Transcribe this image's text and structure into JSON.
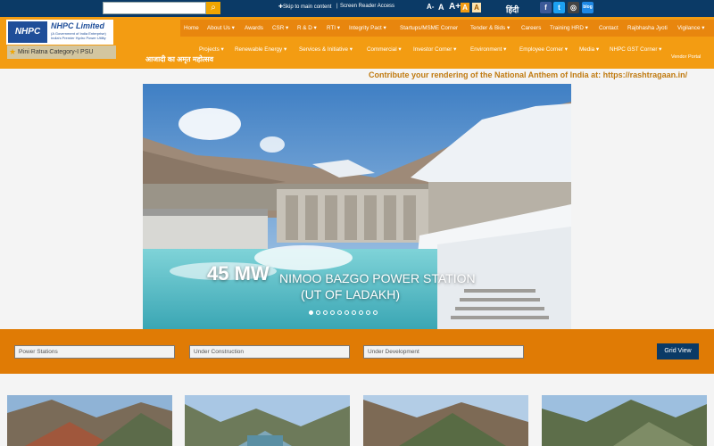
{
  "topbar": {
    "search_placeholder": "",
    "skip_link": "Skip to main content",
    "screen_reader": "Screen Reader Access",
    "font_controls": [
      "A-",
      "A",
      "A+"
    ],
    "contrast": [
      "A",
      "A"
    ],
    "language": "हिंदी",
    "social": [
      {
        "icon": "facebook-icon",
        "glyph": "f",
        "color": "#3b5998"
      },
      {
        "icon": "twitter-icon",
        "glyph": "t",
        "color": "#1da1f2"
      },
      {
        "icon": "instagram-icon",
        "glyph": "◎",
        "color": "#444444"
      },
      {
        "icon": "blog-icon",
        "glyph": "blog",
        "color": "#1e88e5"
      }
    ]
  },
  "brand": {
    "logo_text": "NHPC",
    "title": "NHPC Limited",
    "subtitle_1": "(A Government of India Enterprise)",
    "subtitle_2": "India's Premier Hydro Power Utility",
    "category": "Mini Ratna Category-I PSU",
    "amrit": "आजादी का अमृत महोत्सव",
    "vendor": "Vendor Portal"
  },
  "nav": {
    "row1": [
      "Home",
      "About Us ▾",
      "Awards",
      "CSR ▾",
      "R & D ▾",
      "RTI ▾",
      "Integrity Pact ▾",
      "Startups/MSME Corner",
      "Tender & Bids ▾",
      "Careers",
      "Training HRD ▾",
      "Contact",
      "Rajbhasha Jyoti",
      "Vigilance ▾"
    ],
    "row2": [
      "Projects ▾",
      "Renewable Energy ▾",
      "Services & Initiative ▾",
      "Commercial ▾",
      "Investor Corner ▾",
      "Environment ▾",
      "Employee Corner ▾",
      "Media ▾",
      "NHPC GST Corner ▾"
    ]
  },
  "ticker": "Contribute your rendering of the National Anthem of India at: https://rashtragaan.in/",
  "slider": {
    "capacity": "45 MW",
    "name": "NIMOO BAZGO POWER STATION",
    "location": "(UT OF LADAKH)",
    "slide_count": 10,
    "active_slide": 1
  },
  "filters": {
    "power_stations": "Power Stations",
    "under_construction": "Under Construction",
    "under_development": "Under Development",
    "grid_view": "Grid View"
  },
  "colors": {
    "topbar": "#0b3a66",
    "header": "#f39c12",
    "band": "#e07b05",
    "accent": "#f0a500"
  }
}
